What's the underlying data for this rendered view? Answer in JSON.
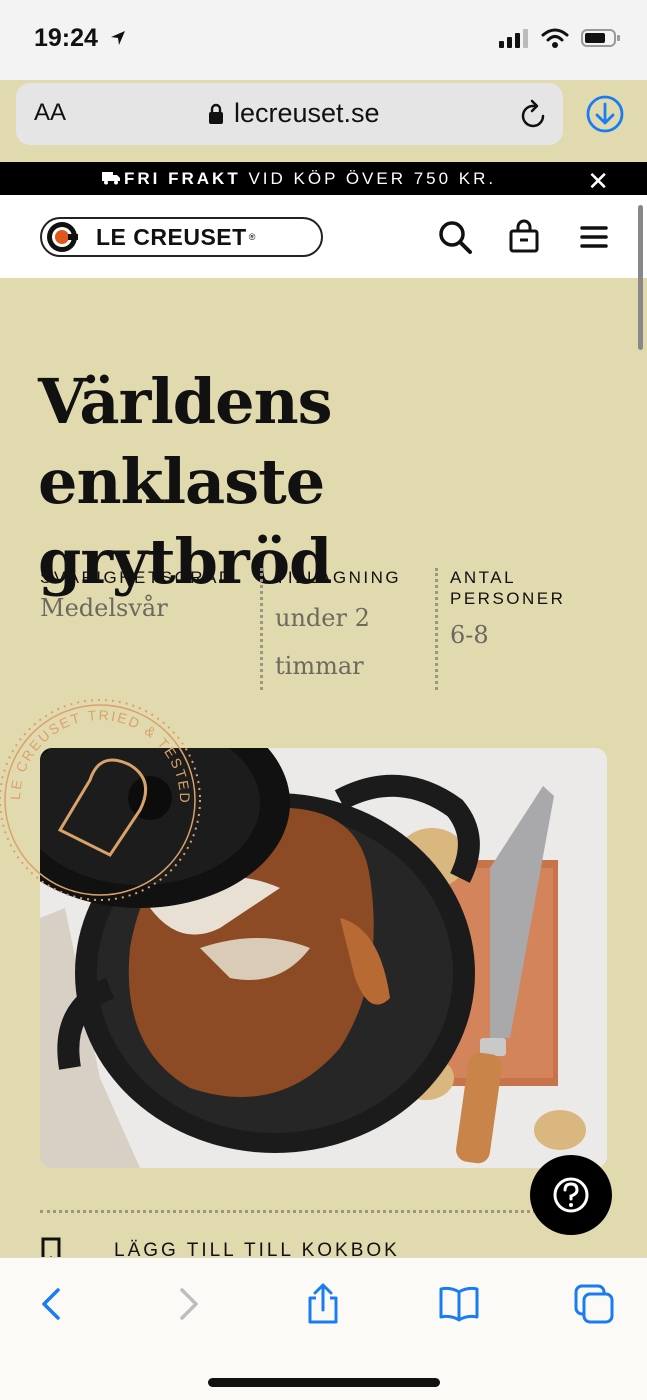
{
  "status": {
    "time": "19:24"
  },
  "browser": {
    "text_size_label": "AA",
    "url": "lecreuset.se"
  },
  "promo": {
    "bold": "FRI FRAKT",
    "text": " VID KÖP ÖVER 750 KR."
  },
  "header": {
    "logo_text": "LE CREUSET"
  },
  "recipe": {
    "title": "Världens enklaste grytbröd",
    "difficulty_label": "SVÅRIGHETSGRAD",
    "difficulty_value": "Medelsvår",
    "time_label": "TILLAGNING",
    "time_value": "under 2 timmar",
    "servings_label": "ANTAL PERSONER",
    "servings_value": "6-8",
    "stamp_text": "LE CREUSET TRIED & TESTED RECIPE",
    "add_to_cookbook": "LÄGG TILL TILL KOKBOK"
  },
  "colors": {
    "background": "#e2daaf",
    "accent_ios": "#1a7cf2",
    "stamp": "#d9a26a"
  }
}
